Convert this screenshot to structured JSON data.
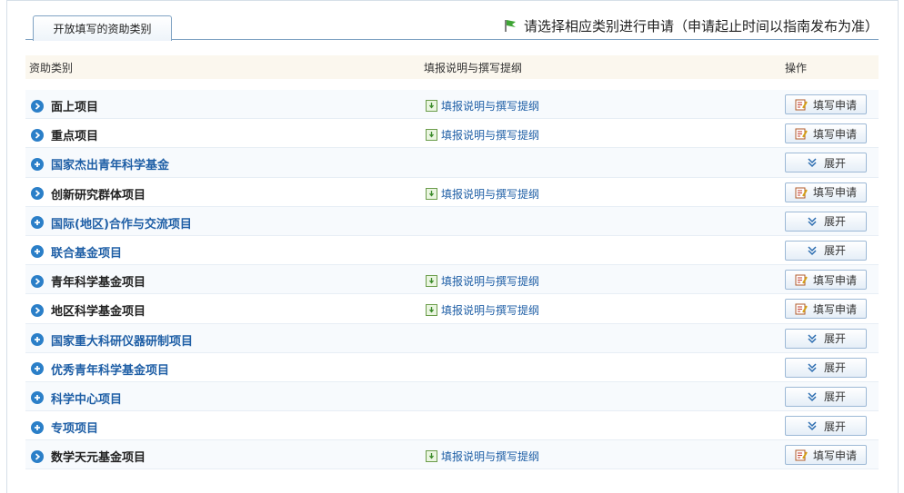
{
  "tab_label": "开放填写的资助类别",
  "notice": "请选择相应类别进行申请（申请起止时间以指南发布为准）",
  "columns": {
    "category": "资助类别",
    "guide": "填报说明与撰写提纲",
    "action": "操作"
  },
  "rows": [
    {
      "name": "面上项目",
      "style": "dark",
      "guide": "填报说明与撰写提纲",
      "action": "填写申请"
    },
    {
      "name": "重点项目",
      "style": "dark",
      "guide": "填报说明与撰写提纲",
      "action": "填写申请"
    },
    {
      "name": "国家杰出青年科学基金",
      "style": "blue",
      "guide": "",
      "action": "展开"
    },
    {
      "name": "创新研究群体项目",
      "style": "dark",
      "guide": "填报说明与撰写提纲",
      "action": "填写申请"
    },
    {
      "name": "国际(地区)合作与交流项目",
      "style": "blue",
      "guide": "",
      "action": "展开"
    },
    {
      "name": "联合基金项目",
      "style": "blue",
      "guide": "",
      "action": "展开"
    },
    {
      "name": "青年科学基金项目",
      "style": "dark",
      "guide": "填报说明与撰写提纲",
      "action": "填写申请"
    },
    {
      "name": "地区科学基金项目",
      "style": "dark",
      "guide": "填报说明与撰写提纲",
      "action": "填写申请"
    },
    {
      "name": "国家重大科研仪器研制项目",
      "style": "blue",
      "guide": "",
      "action": "展开"
    },
    {
      "name": "优秀青年科学基金项目",
      "style": "blue",
      "guide": "",
      "action": "展开"
    },
    {
      "name": "科学中心项目",
      "style": "blue",
      "guide": "",
      "action": "展开"
    },
    {
      "name": "专项项目",
      "style": "blue",
      "guide": "",
      "action": "展开"
    },
    {
      "name": "数学天元基金项目",
      "style": "dark",
      "guide": "填报说明与撰写提纲",
      "action": "填写申请"
    }
  ],
  "colors": {
    "accent": "#2b7fc8",
    "link": "#1f5fa6",
    "header_bg": "#fbf7ee"
  }
}
